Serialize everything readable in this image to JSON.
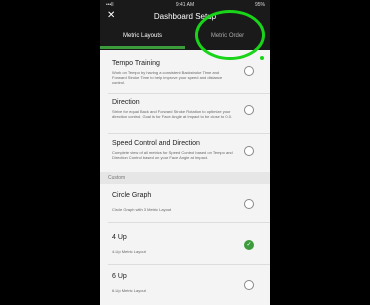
{
  "status": {
    "signal": "•••ll",
    "time": "9:41 AM",
    "battery": "95%"
  },
  "header": {
    "close": "✕",
    "title": "Dashboard Setup"
  },
  "tabs": [
    {
      "label": "Metric Layouts"
    },
    {
      "label": "Metric Order"
    }
  ],
  "items": [
    {
      "title": "Tempo Training",
      "desc": "Work on Tempo by having a consistent Backstroke Time and Forward Stroke Time to help improve your speed and distance control.",
      "selected": false
    },
    {
      "title": "Direction",
      "desc": "Strive for equal Back and Forward Stroke Rotation to optimize your direction control. Goal is for Face Angle at Impact to be close to 0.0.",
      "selected": false
    },
    {
      "title": "Speed Control and Direction",
      "desc": "Complete view of all metrics for Speed Control based on Tempo and Direction Control based on your Face Angle at Impact.",
      "selected": false
    }
  ],
  "section": "Custom",
  "custom_items": [
    {
      "title": "Circle Graph",
      "desc": "Circle Graph with 3 Metric Layout",
      "selected": false
    },
    {
      "title": "4 Up",
      "desc": "4-Up Metric Layout",
      "selected": true
    },
    {
      "title": "6 Up",
      "desc": "6-Up Metric Layout",
      "selected": false
    }
  ]
}
